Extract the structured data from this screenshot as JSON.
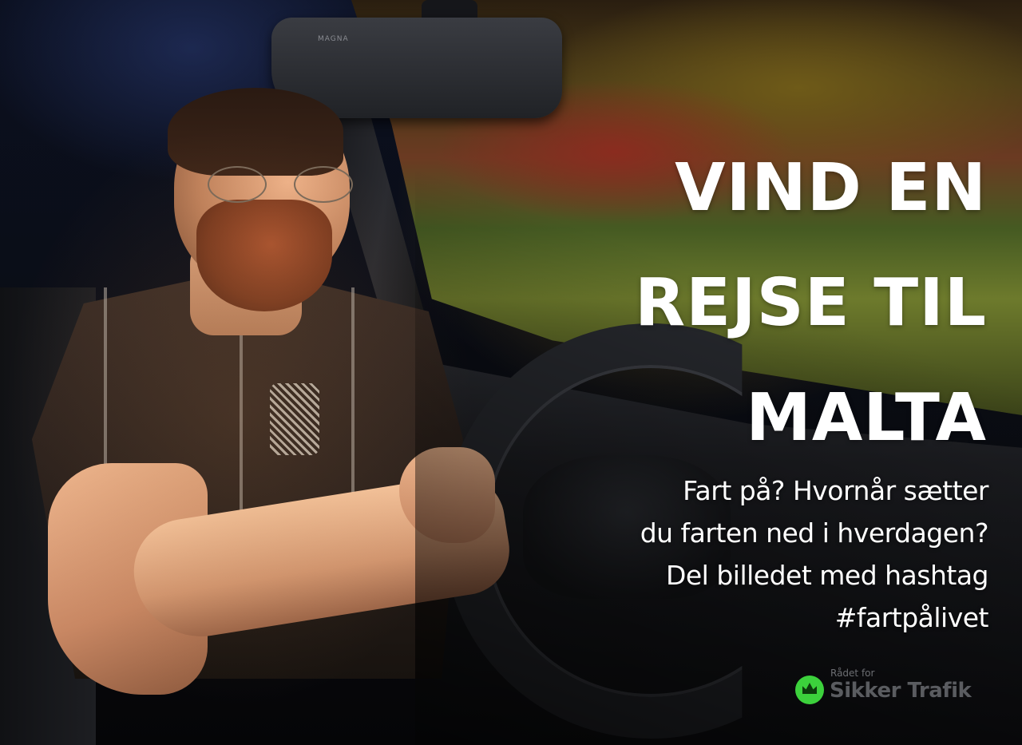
{
  "headline": {
    "lines": [
      "VIND EN",
      "REJSE TIL",
      "MALTA"
    ]
  },
  "subtext": {
    "lines": [
      "Fart på? Hvornår sætter",
      "du farten ned i hverdagen?",
      "Del billedet med hashtag",
      "#fartpålivet"
    ]
  },
  "logo": {
    "small": "Rådet for",
    "big": "Sikker Trafik",
    "icon": "crown-icon",
    "badge_color": "#3cd13c"
  },
  "mirror": {
    "brand": "MAGNA"
  },
  "colors": {
    "headline": "#ffffff",
    "subtext": "#ffffff"
  }
}
